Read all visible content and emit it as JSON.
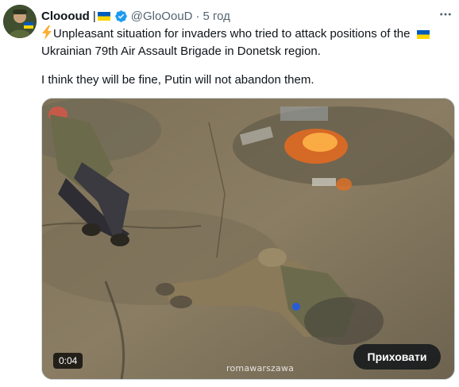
{
  "tweet": {
    "display_name": "Cloooud",
    "separator": "|",
    "flag_icon": "ukraine-flag-icon",
    "verified_icon": "verified-badge-icon",
    "handle": "@GloOouD",
    "dot": "·",
    "timestamp": "5 год",
    "more_icon": "more-options-icon",
    "line1": "Unpleasant situation for invaders who tried to attack positions of the",
    "line2": "Ukrainian 79th Air Assault Brigade in Donetsk region.",
    "line3": "I think they will be fine, Putin will not abandon them.",
    "lightning_icon": "high-voltage-emoji-icon"
  },
  "media": {
    "duration": "0:04",
    "hide_button_label": "Приховати",
    "watermark": "romawarszawa"
  },
  "colors": {
    "flag_blue": "#005bbb",
    "flag_yellow": "#ffd500",
    "verified_blue": "#1d9bf0",
    "muted_text": "#536471"
  }
}
